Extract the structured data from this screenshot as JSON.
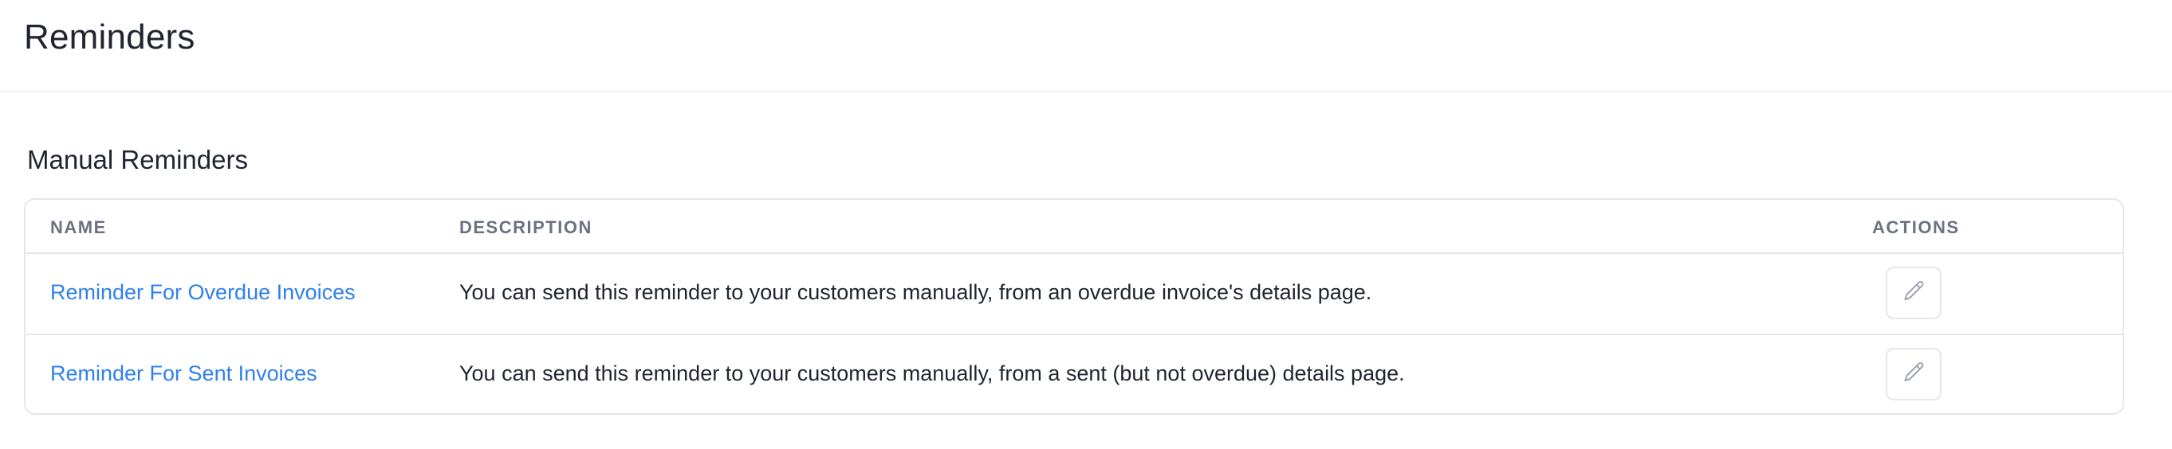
{
  "page": {
    "title": "Reminders"
  },
  "section": {
    "title": "Manual Reminders"
  },
  "table": {
    "columns": {
      "name": "NAME",
      "description": "DESCRIPTION",
      "actions": "ACTIONS"
    },
    "rows": [
      {
        "name": "Reminder For Overdue Invoices",
        "description": "You can send this reminder to your customers manually, from an overdue invoice's details page.",
        "action_icon": "pencil-icon"
      },
      {
        "name": "Reminder For Sent Invoices",
        "description": "You can send this reminder to your customers manually, from a sent (but not overdue) details page.",
        "action_icon": "pencil-icon"
      }
    ]
  },
  "colors": {
    "link": "#2f80ed",
    "text": "#1f2430",
    "header_text": "#6b7280",
    "border": "#e5e7eb"
  }
}
